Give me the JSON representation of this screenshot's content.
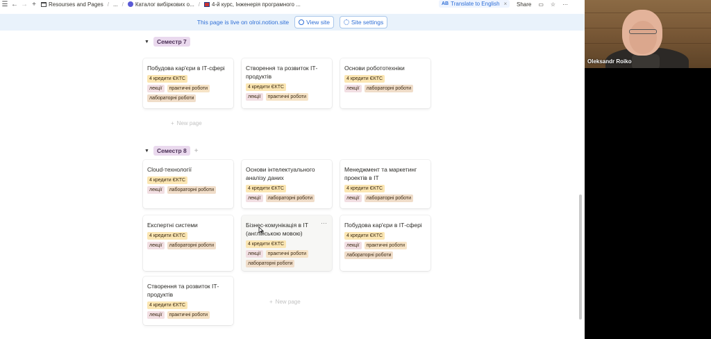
{
  "topbar": {
    "crumbs": [
      {
        "label": "Resourses and Pages"
      },
      {
        "label": "..."
      },
      {
        "label": "Каталог вибіркових о..."
      },
      {
        "label": "4-й курс, Інженерія програмного ..."
      }
    ],
    "translate_badge": "AB",
    "translate_label": "Translate to English",
    "translate_close": "×",
    "share_label": "Share"
  },
  "banner": {
    "text": "This page is live on olroi.notion.site",
    "view_site": "View site",
    "site_settings": "Site settings"
  },
  "groups": [
    {
      "label": "Семестр 7",
      "cards": [
        {
          "title": "Побудова кар'єри в ІТ-сфері",
          "rows": [
            [
              "4 кредити ЄКТС"
            ],
            [
              "лекції",
              "практичні роботи"
            ],
            [
              "лабораторні роботи"
            ]
          ]
        },
        {
          "title": "Створення та розвиток ІТ-продуктів",
          "rows": [
            [
              "4 кредити ЄКТС"
            ],
            [
              "лекції",
              "практичні роботи"
            ]
          ]
        },
        {
          "title": "Основи робототехніки",
          "rows": [
            [
              "4 кредити ЄКТС"
            ],
            [
              "лекції",
              "лабораторні роботи"
            ]
          ]
        }
      ],
      "new_page": "New page"
    },
    {
      "label": "Семестр 8",
      "cards": [
        {
          "title": "Cloud-технології",
          "rows": [
            [
              "4 кредити ЄКТС"
            ],
            [
              "лекції",
              "лабораторні роботи"
            ]
          ]
        },
        {
          "title": "Основи інтелектуального аналізу даних",
          "rows": [
            [
              "4 кредити ЄКТС"
            ],
            [
              "лекції",
              "лабораторні роботи"
            ]
          ]
        },
        {
          "title": "Менеджмент та маркетинг проектів в ІТ",
          "rows": [
            [
              "4 кредити ЄКТС"
            ],
            [
              "лекції",
              "лабораторні роботи"
            ]
          ]
        },
        {
          "title": "Експертні системи",
          "rows": [
            [
              "4 кредити ЄКТС"
            ],
            [
              "лекції",
              "лабораторні роботи"
            ]
          ]
        },
        {
          "title": "Бізнес-комунікація в ІТ (англійською мовою)",
          "rows": [
            [
              "4 кредити ЄКТС"
            ],
            [
              "лекції",
              "практичні роботи"
            ],
            [
              "лабораторні роботи"
            ]
          ],
          "more": "···"
        },
        {
          "title": "Побудова кар'єри в ІТ-сфері",
          "rows": [
            [
              "4 кредити ЄКТС"
            ],
            [
              "лекції",
              "практичні роботи"
            ],
            [
              "лабораторні роботи"
            ]
          ]
        },
        {
          "title": "Створення та розвиток ІТ-продуктів",
          "rows": [
            [
              "4 кредити ЄКТС"
            ],
            [
              "лекції",
              "практичні роботи"
            ]
          ]
        }
      ],
      "new_page": "New page",
      "add": "+"
    }
  ],
  "video": {
    "participant_name": "Oleksandr Roiko"
  }
}
